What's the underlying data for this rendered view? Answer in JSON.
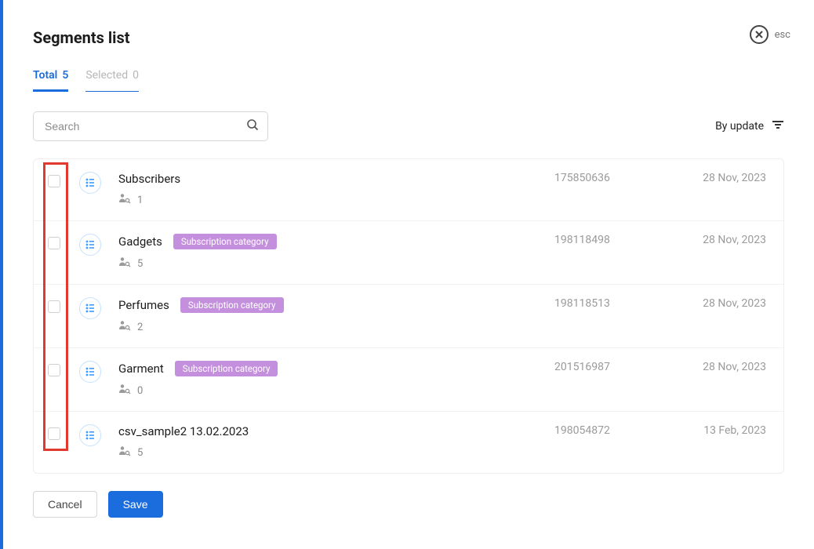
{
  "header": {
    "title": "Segments list",
    "esc_label": "esc"
  },
  "tabs": {
    "total_label": "Total",
    "total_count": "5",
    "selected_label": "Selected",
    "selected_count": "0"
  },
  "search": {
    "placeholder": "Search"
  },
  "sort": {
    "label": "By update"
  },
  "segments": [
    {
      "name": "Subscribers",
      "tag": null,
      "people": "1",
      "id": "175850636",
      "date": "28 Nov, 2023"
    },
    {
      "name": "Gadgets",
      "tag": "Subscription category",
      "people": "5",
      "id": "198118498",
      "date": "28 Nov, 2023"
    },
    {
      "name": "Perfumes",
      "tag": "Subscription category",
      "people": "2",
      "id": "198118513",
      "date": "28 Nov, 2023"
    },
    {
      "name": "Garment",
      "tag": "Subscription category",
      "people": "0",
      "id": "201516987",
      "date": "28 Nov, 2023"
    },
    {
      "name": "csv_sample2 13.02.2023",
      "tag": null,
      "people": "5",
      "id": "198054872",
      "date": "13 Feb, 2023"
    }
  ],
  "footer": {
    "cancel": "Cancel",
    "save": "Save"
  }
}
